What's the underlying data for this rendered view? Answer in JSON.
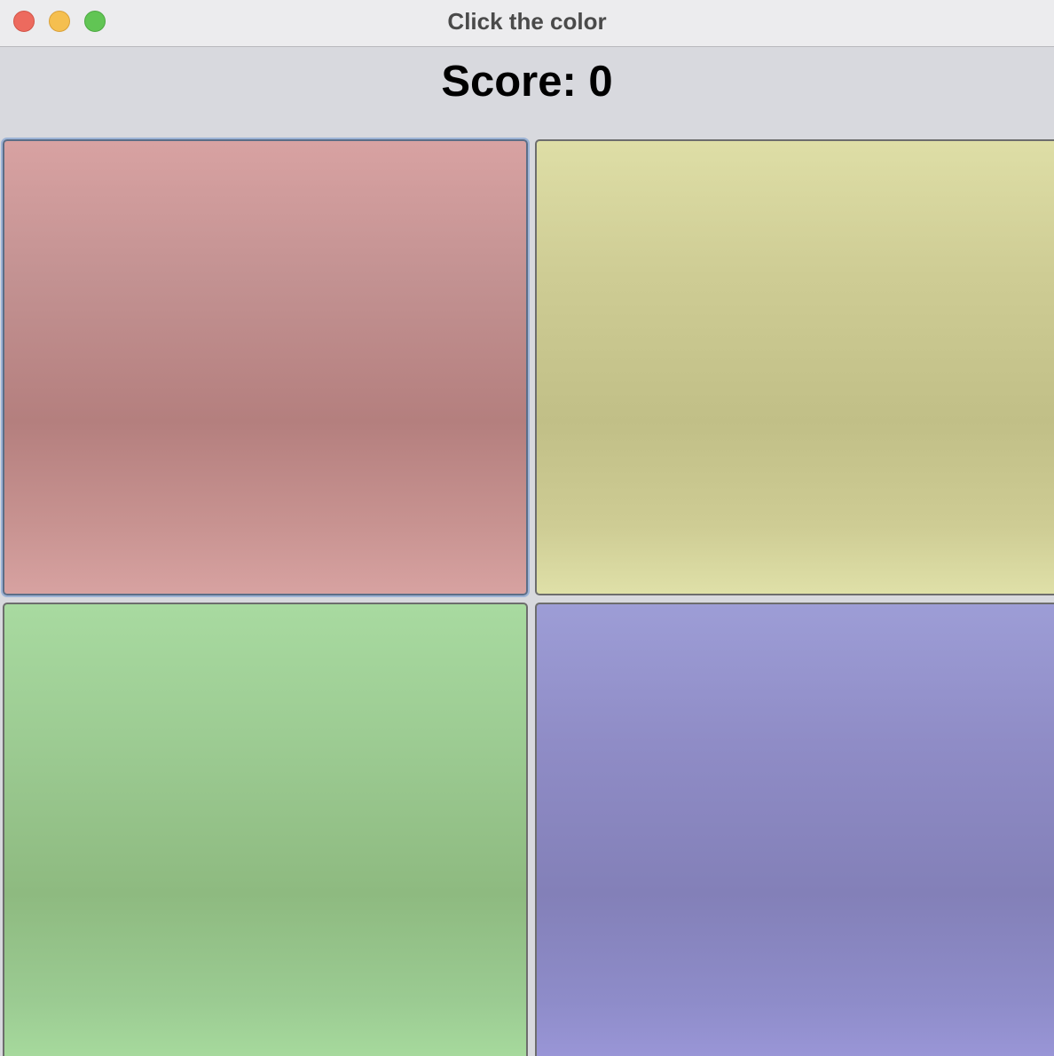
{
  "window": {
    "title": "Click the color",
    "controls": [
      "close-icon",
      "minimize-icon",
      "zoom-icon"
    ]
  },
  "score": {
    "label": "Score: 0"
  },
  "tiles": [
    {
      "color_name": "red",
      "color": "#c39292"
    },
    {
      "color_name": "yellow",
      "color": "#cecc94"
    },
    {
      "color_name": "green",
      "color": "#9ccb92"
    },
    {
      "color_name": "blue",
      "color": "#8f8cc6"
    }
  ]
}
